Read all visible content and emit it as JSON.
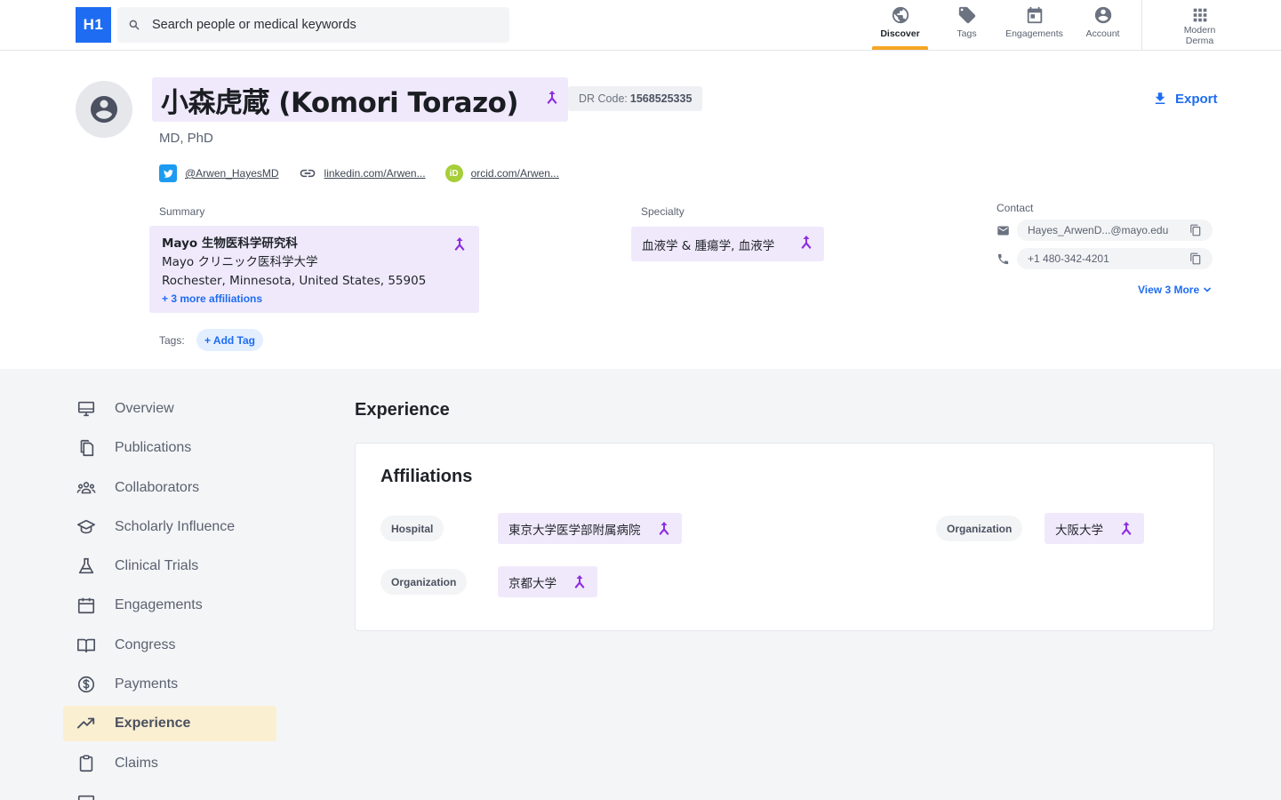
{
  "header": {
    "logo": "H1",
    "search_placeholder": "Search people or medical keywords",
    "nav": [
      {
        "label": "Discover",
        "icon": "globe-icon",
        "active": true
      },
      {
        "label": "Tags",
        "icon": "tag-icon"
      },
      {
        "label": "Engagements",
        "icon": "calendar-icon"
      },
      {
        "label": "Account",
        "icon": "account-circle-icon"
      },
      {
        "label": "Modern Derma",
        "icon": "apps-grid-icon"
      }
    ]
  },
  "profile": {
    "name": "小森虎蔵 (Komori Torazo)",
    "dr_code_label": "DR Code:",
    "dr_code": "1568525335",
    "export_label": "Export",
    "degree": "MD, PhD",
    "socials": {
      "twitter": "@Arwen_HayesMD",
      "linkedin": "linkedin.com/Arwen...",
      "orcid": "orcid.com/Arwen..."
    },
    "summary_label": "Summary",
    "summary": {
      "org": "Mayo 生物医科学研究科",
      "line2": "Mayo クリニック医科学大学",
      "line3": "Rochester, Minnesota, United States, 55905",
      "more": "+ 3 more affiliations"
    },
    "specialty_label": "Specialty",
    "specialty": "血液学 & 腫瘍学, 血液学",
    "contact_label": "Contact",
    "email": "Hayes_ArwenD...@mayo.edu",
    "phone": "+1 480-342-4201",
    "view_more": "View 3 More",
    "tags_label": "Tags:",
    "add_tag": "+ Add Tag"
  },
  "sidenav": {
    "items": [
      {
        "label": "Overview",
        "icon": "monitor-icon"
      },
      {
        "label": "Publications",
        "icon": "documents-icon"
      },
      {
        "label": "Collaborators",
        "icon": "people-group-icon"
      },
      {
        "label": "Scholarly Influence",
        "icon": "graduation-cap-icon"
      },
      {
        "label": "Clinical Trials",
        "icon": "flask-icon"
      },
      {
        "label": "Engagements",
        "icon": "calendar-icon"
      },
      {
        "label": "Congress",
        "icon": "book-open-icon"
      },
      {
        "label": "Payments",
        "icon": "dollar-circle-icon"
      },
      {
        "label": "Experience",
        "icon": "trending-up-icon",
        "active": true
      },
      {
        "label": "Claims",
        "icon": "clipboard-icon"
      }
    ]
  },
  "main": {
    "section_title": "Experience",
    "card_title": "Affiliations",
    "affiliations": [
      {
        "type": "Hospital",
        "name": "東京大学医学部附属病院"
      },
      {
        "type": "Organization",
        "name": "大阪大学"
      },
      {
        "type": "Organization",
        "name": "京都大学"
      }
    ]
  },
  "colors": {
    "brand_blue": "#1e6cf2",
    "accent_yellow": "#f5a623",
    "merge_purple": "#8e2de2",
    "highlight_lavender": "#f0e9fb"
  }
}
